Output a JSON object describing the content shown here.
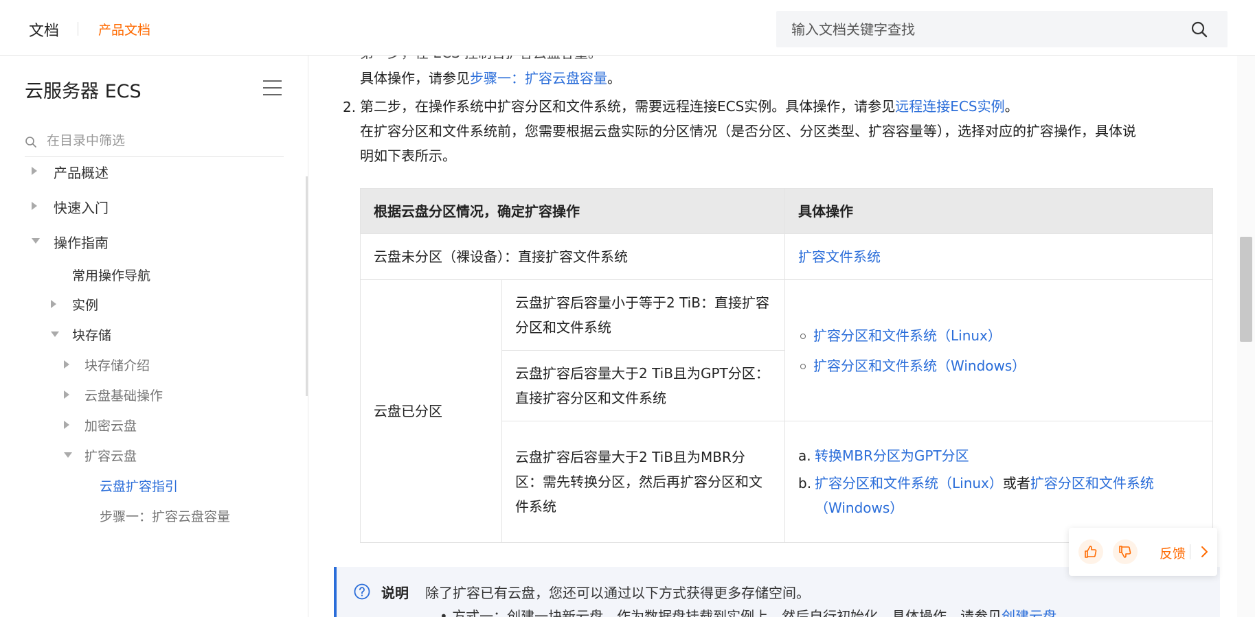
{
  "header": {
    "brand": "文档",
    "breadcrumb": "产品文档",
    "search_placeholder": "输入文档关键字查找"
  },
  "sidebar": {
    "title": "云服务器 ECS",
    "filter_placeholder": "在目录中筛选",
    "items": [
      {
        "label": "产品概述"
      },
      {
        "label": "快速入门"
      },
      {
        "label": "操作指南"
      },
      {
        "label": "常用操作导航"
      },
      {
        "label": "实例"
      },
      {
        "label": "块存储"
      },
      {
        "label": "块存储介绍"
      },
      {
        "label": "云盘基础操作"
      },
      {
        "label": "加密云盘"
      },
      {
        "label": "扩容云盘"
      },
      {
        "label": "云盘扩容指引"
      },
      {
        "label": "步骤一：扩容云盘容量"
      }
    ]
  },
  "content": {
    "cut_line": "第一步，在 ECS 控制台扩容云盘容量。",
    "step1_prefix": "具体操作，请参见",
    "step1_link": "步骤一：扩容云盘容量",
    "step1_suffix": "。",
    "step2_num": "2.",
    "step2_text": "第二步，在操作系统中扩容分区和文件系统，需要远程连接ECS实例。具体操作，请参见",
    "step2_link": "远程连接ECS实例",
    "step2_suffix": "。",
    "step2_desc_line1": "在扩容分区和文件系统前，您需要根据云盘实际的分区情况（是否分区、分区类型、扩容容量等），选择对应的扩容操作，具体说",
    "step2_desc_line2": "明如下表所示。",
    "table": {
      "head_condition": "根据云盘分区情况，确定扩容操作",
      "head_action": "具体操作",
      "row1_condition": "云盘未分区（裸设备）：直接扩容文件系统",
      "row1_action": "扩容文件系统",
      "group_label": "云盘已分区",
      "row2_condition": "云盘扩容后容量小于等于2 TiB：直接扩容分区和文件系统",
      "row3_condition": "云盘扩容后容量大于2 TiB且为GPT分区：直接扩容分区和文件系统",
      "row23_action_linux": "扩容分区和文件系统（Linux）",
      "row23_action_windows": "扩容分区和文件系统（Windows）",
      "row4_condition": "云盘扩容后容量大于2 TiB且为MBR分区：需先转换分区，然后再扩容分区和文件系统",
      "row4_a_marker": "a.",
      "row4_a_link": "转换MBR分区为GPT分区",
      "row4_b_marker": "b.",
      "row4_b_link1": "扩容分区和文件系统（Linux）",
      "row4_b_or": "或者",
      "row4_b_link2": "扩容分区和文件系统（Windows）"
    },
    "note": {
      "label": "说明",
      "text": "除了扩容已有云盘，您还可以通过以下方式获得更多存储空间。",
      "sub_prefix": "方式一：创建一块新云盘，作为数据盘挂载到实例上，然后自行初始化。具体操作，请参见",
      "sub_link": "创建云盘"
    }
  },
  "feedback": {
    "label": "反馈"
  },
  "colors": {
    "accent": "#ff6a00",
    "link": "#2a6dd9",
    "table_header_bg": "#e9e9e9",
    "note_bg": "#f3f5fa"
  }
}
